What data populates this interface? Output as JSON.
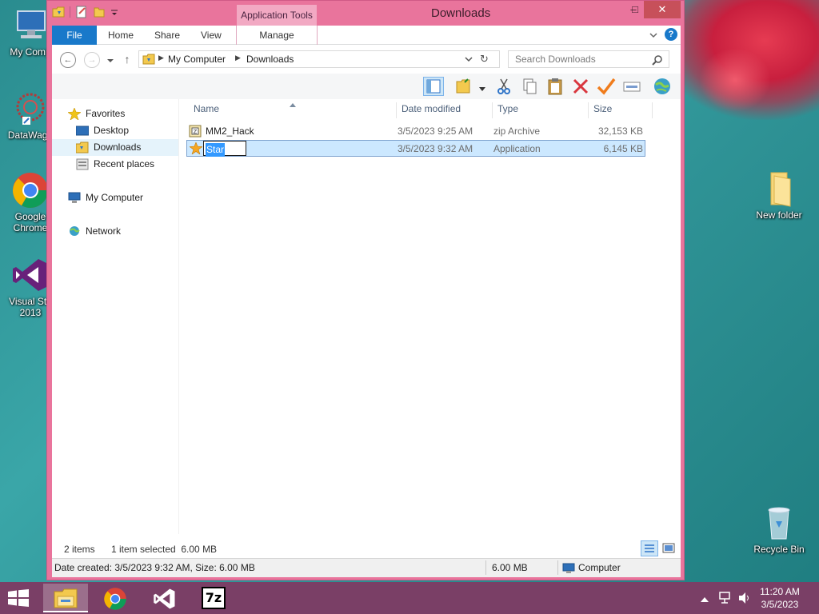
{
  "desktop": {
    "icons": [
      {
        "label": "My Comp",
        "icon": "computer-icon"
      },
      {
        "label": "DataWago",
        "icon": "datawagon-icon"
      },
      {
        "label": "Google\nChrome",
        "line1": "Google",
        "line2": "Chrome",
        "icon": "chrome-icon"
      },
      {
        "line1": "Visual Stu",
        "line2": "2013",
        "icon": "visual-studio-icon"
      },
      {
        "label": "New folder",
        "icon": "folder-icon"
      },
      {
        "label": "Recycle Bin",
        "icon": "recycle-bin-icon"
      }
    ]
  },
  "window": {
    "title": "Downloads",
    "context_tab": "Application Tools",
    "controls": {
      "minimize": "–",
      "maximize": "□",
      "close": "✕"
    },
    "ribbon_tabs": [
      "File",
      "Home",
      "Share",
      "View",
      "Manage"
    ],
    "help": "?",
    "address": {
      "segments": [
        "My Computer",
        "Downloads"
      ]
    },
    "search_placeholder": "Search Downloads"
  },
  "navpane": {
    "favorites": "Favorites",
    "items": [
      "Desktop",
      "Downloads",
      "Recent places"
    ],
    "computer": "My Computer",
    "network": "Network"
  },
  "columns": [
    "Name",
    "Date modified",
    "Type",
    "Size"
  ],
  "files": [
    {
      "name": "MM2_Hack",
      "date": "3/5/2023 9:25 AM",
      "type": "zip Archive",
      "size": "32,153 KB",
      "icon": "zip-icon"
    },
    {
      "name": "Star",
      "date": "3/5/2023 9:32 AM",
      "type": "Application",
      "size": "6,145 KB",
      "icon": "star-icon"
    }
  ],
  "status": {
    "items": "2 items",
    "selected": "1 item selected  6.00 MB"
  },
  "details": {
    "created": "Date created: 3/5/2023 9:32 AM, Size: 6.00 MB",
    "size": "6.00 MB",
    "location": "Computer"
  },
  "taskbar": {
    "apps": [
      "file-explorer-icon",
      "chrome-icon",
      "visual-studio-icon",
      "7zip-icon"
    ],
    "sevenzip_label": "7z",
    "time": "11:20 AM",
    "date": "3/5/2023"
  }
}
